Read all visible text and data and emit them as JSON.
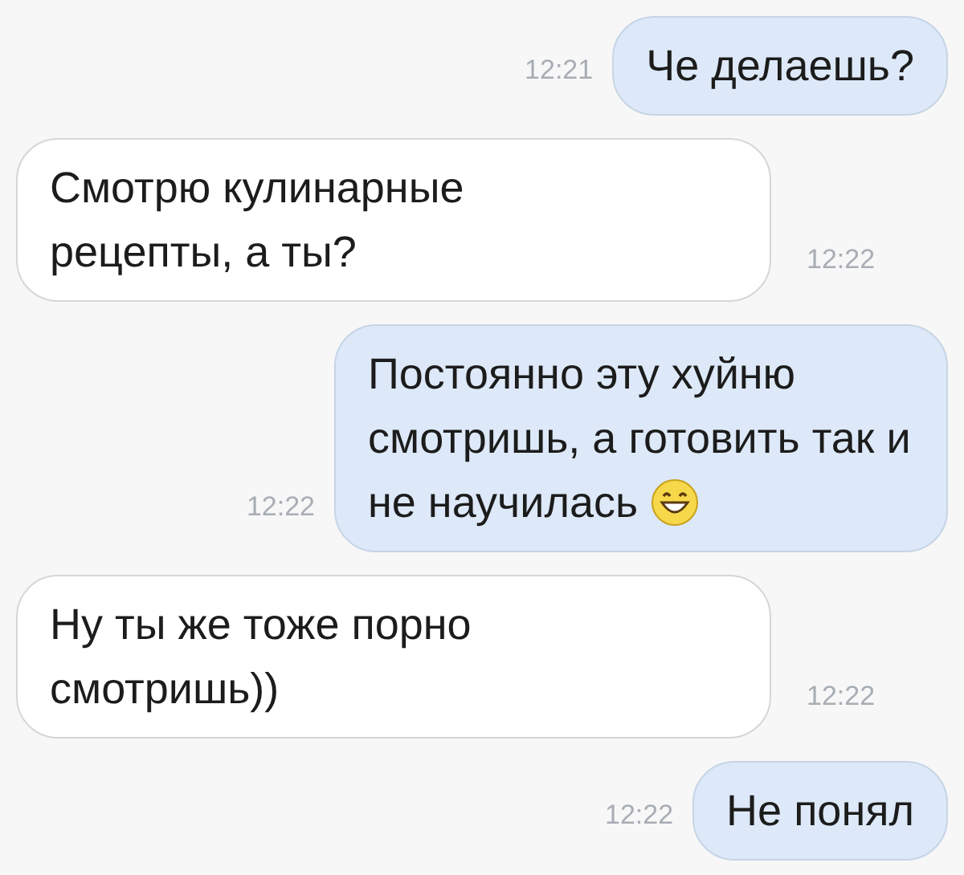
{
  "messages": [
    {
      "kind": "outgoing",
      "text": "Че делаешь?",
      "time": "12:21"
    },
    {
      "kind": "incoming",
      "text": "Смотрю кулинарные рецепты, а ты?",
      "time": "12:22"
    },
    {
      "kind": "outgoing",
      "text": "Постоянно эту хуйню смотришь, а готовить так и не научилась",
      "time": "12:22",
      "emoji": true
    },
    {
      "kind": "incoming",
      "text": "Ну ты же тоже порно смотришь))",
      "time": "12:22"
    },
    {
      "kind": "outgoing",
      "text": "Не понял",
      "time": "12:22"
    }
  ]
}
